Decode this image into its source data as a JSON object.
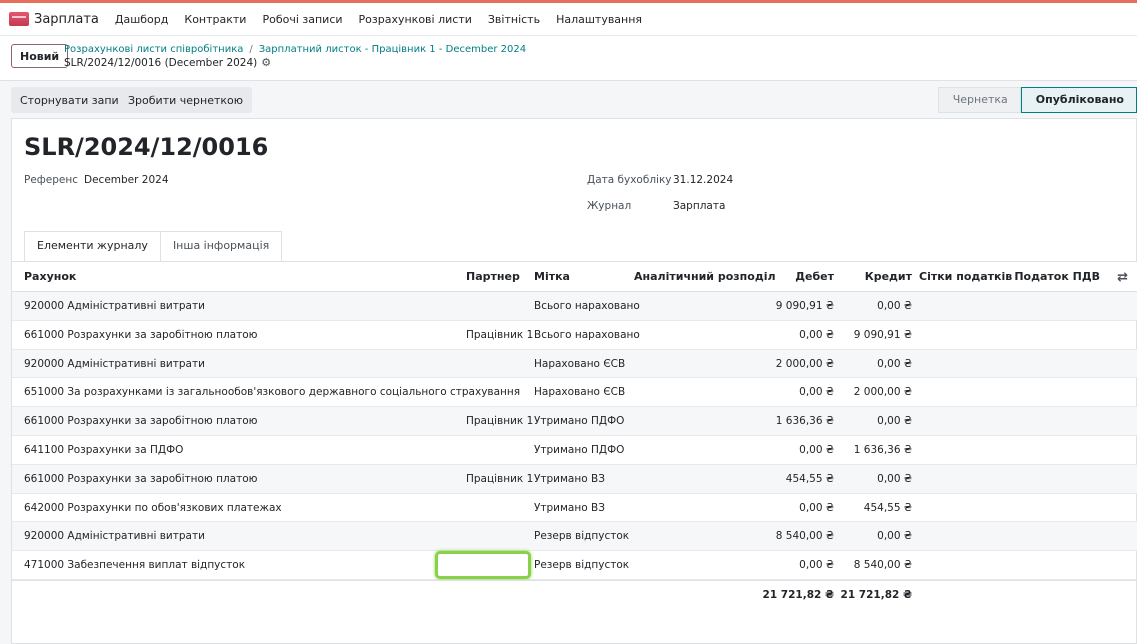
{
  "navbar": {
    "app_name": "Зарплата",
    "items": [
      "Дашборд",
      "Контракти",
      "Робочі записи",
      "Розрахункові листи",
      "Звітність",
      "Налаштування"
    ]
  },
  "control": {
    "new_label": "Новий",
    "breadcrumb": [
      "Розрахункові листи співробітника",
      "Зарплатний листок - Працівник 1 - December 2024"
    ],
    "record_name": "SLR/2024/12/0016 (December 2024)"
  },
  "actions": {
    "reverse_label": "Сторнувати запис",
    "draft_label": "Зробити чернеткою"
  },
  "status": {
    "steps": [
      "Чернетка",
      "Опубліковано"
    ],
    "active": "Опубліковано"
  },
  "form": {
    "title": "SLR/2024/12/0016",
    "reference_label": "Референс",
    "reference_value": "December 2024",
    "date_label": "Дата бухобліку",
    "date_value": "31.12.2024",
    "journal_label": "Журнал",
    "journal_value": "Зарплата"
  },
  "tabs": [
    "Елементи журналу",
    "Інша інформація"
  ],
  "table": {
    "headers": {
      "account": "Рахунок",
      "partner": "Партнер",
      "label": "Мітка",
      "analytic": "Аналітичний розподіл",
      "debit": "Дебет",
      "credit": "Кредит",
      "tax_grids": "Сітки податків",
      "tax": "Податок ПДВ"
    },
    "rows": [
      {
        "account": "920000 Адміністративні витрати",
        "partner": "",
        "label": "Всього нараховано",
        "debit": "9 090,91 ₴",
        "credit": "0,00 ₴"
      },
      {
        "account": "661000 Розрахунки за заробітною платою",
        "partner": "Працівник 1",
        "label": "Всього нараховано",
        "debit": "0,00 ₴",
        "credit": "9 090,91 ₴"
      },
      {
        "account": "920000 Адміністративні витрати",
        "partner": "",
        "label": "Нараховано ЄСВ",
        "debit": "2 000,00 ₴",
        "credit": "0,00 ₴"
      },
      {
        "account": "651000 За розрахунками із загальнообов'язкового державного соціального страхування",
        "partner": "",
        "label": "Нараховано ЄСВ",
        "debit": "0,00 ₴",
        "credit": "2 000,00 ₴"
      },
      {
        "account": "661000 Розрахунки за заробітною платою",
        "partner": "Працівник 1",
        "label": "Утримано ПДФО",
        "debit": "1 636,36 ₴",
        "credit": "0,00 ₴"
      },
      {
        "account": "641100 Розрахунки за ПДФО",
        "partner": "",
        "label": "Утримано ПДФО",
        "debit": "0,00 ₴",
        "credit": "1 636,36 ₴"
      },
      {
        "account": "661000 Розрахунки за заробітною платою",
        "partner": "Працівник 1",
        "label": "Утримано ВЗ",
        "debit": "454,55 ₴",
        "credit": "0,00 ₴"
      },
      {
        "account": "642000 Розрахунки по обов'язкових платежах",
        "partner": "",
        "label": "Утримано ВЗ",
        "debit": "0,00 ₴",
        "credit": "454,55 ₴"
      },
      {
        "account": "920000 Адміністративні витрати",
        "partner": "",
        "label": "Резерв відпусток",
        "debit": "8 540,00 ₴",
        "credit": "0,00 ₴"
      },
      {
        "account": "471000 Забезпечення виплат відпусток",
        "partner": "",
        "label": "Резерв відпусток",
        "debit": "0,00 ₴",
        "credit": "8 540,00 ₴"
      }
    ],
    "total_debit": "21 721,82 ₴",
    "total_credit": "21 721,82 ₴"
  }
}
